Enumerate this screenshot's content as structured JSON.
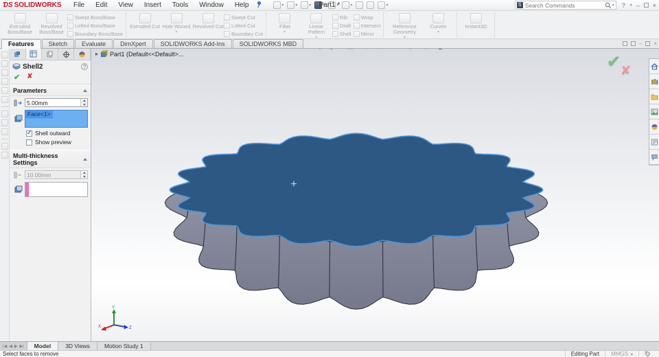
{
  "titlebar": {
    "logo_mark": "ƊS",
    "logo_text": "SOLIDWORKS",
    "menus": [
      "File",
      "Edit",
      "View",
      "Insert",
      "Tools",
      "Window",
      "Help"
    ],
    "title": "Part1 *",
    "search_placeholder": "Search Commands",
    "quick_access": [
      "new",
      "open",
      "save",
      "print",
      "undo",
      "select",
      "rebuild",
      "file-properties",
      "options"
    ]
  },
  "ribbon": {
    "groups": [
      {
        "big": [
          "Extruded Boss/Base",
          "Revolved Boss/Base"
        ],
        "small": [
          "Swept Boss/Base",
          "Lofted Boss/Base",
          "Boundary Boss/Base"
        ]
      },
      {
        "big": [
          "Extruded Cut",
          "Hole Wizard",
          "Revolved Cut"
        ],
        "small": [
          "Swept Cut",
          "Lofted Cut",
          "Boundary Cut"
        ]
      },
      {
        "big": [
          "Fillet",
          "Linear Pattern"
        ],
        "small": [
          "Rib",
          "Draft",
          "Shell",
          "Wrap",
          "Intersect",
          "Mirror"
        ]
      },
      {
        "big": [
          "Reference Geometry",
          "Curves"
        ],
        "small": []
      },
      {
        "big": [
          "Instant3D"
        ],
        "small": []
      }
    ]
  },
  "command_tabs": [
    "Features",
    "Sketch",
    "Evaluate",
    "DimXpert",
    "SOLIDWORKS Add-Ins",
    "SOLIDWORKS MBD"
  ],
  "active_command_tab": "Features",
  "property_manager": {
    "title": "Shell2",
    "help_glyph": "?",
    "parameters": {
      "label": "Parameters",
      "thickness": "5.00mm",
      "face_items": [
        "Face<1>"
      ],
      "shell_outward_label": "Shell outward",
      "shell_outward_checked": true,
      "show_preview_label": "Show preview",
      "show_preview_checked": false
    },
    "multi": {
      "label": "Multi-thickness Settings",
      "thickness": "10.00mm"
    }
  },
  "feature_tree": {
    "root_label": "Part1 (Default<<Default>..."
  },
  "headsup_icons": [
    "zoom-to-fit",
    "zoom-to-area",
    "previous-view",
    "section-view",
    "view-orientation",
    "display-style",
    "hide-show-items",
    "edit-appearance",
    "apply-scene",
    "view-settings"
  ],
  "task_pane_icons": [
    "solidworks-resources",
    "design-library",
    "file-explorer",
    "view-palette",
    "appearances-scenes",
    "custom-properties",
    "solidworks-forum"
  ],
  "bottom_tabs": [
    "Model",
    "3D Views",
    "Motion Study 1"
  ],
  "active_bottom_tab": "Model",
  "statusbar": {
    "left": "Select faces to remove",
    "mode": "Editing Part",
    "units": "MMGS"
  },
  "colors": {
    "brand_red": "#c8102e",
    "face_blue": "#2d5884",
    "rim_highlight": "#4e94d8",
    "body_gray_light": "#9094a6",
    "body_gray_dark": "#747789",
    "edge_dark": "#262b36",
    "selection_blue": "#4d97e6",
    "selection_pink": "#f26cb8",
    "ok_green": "#3fae4a",
    "cancel_red": "#d23b3b",
    "triad_x": "#cc2222",
    "triad_y": "#1a9a1a",
    "triad_z": "#2244cc"
  }
}
